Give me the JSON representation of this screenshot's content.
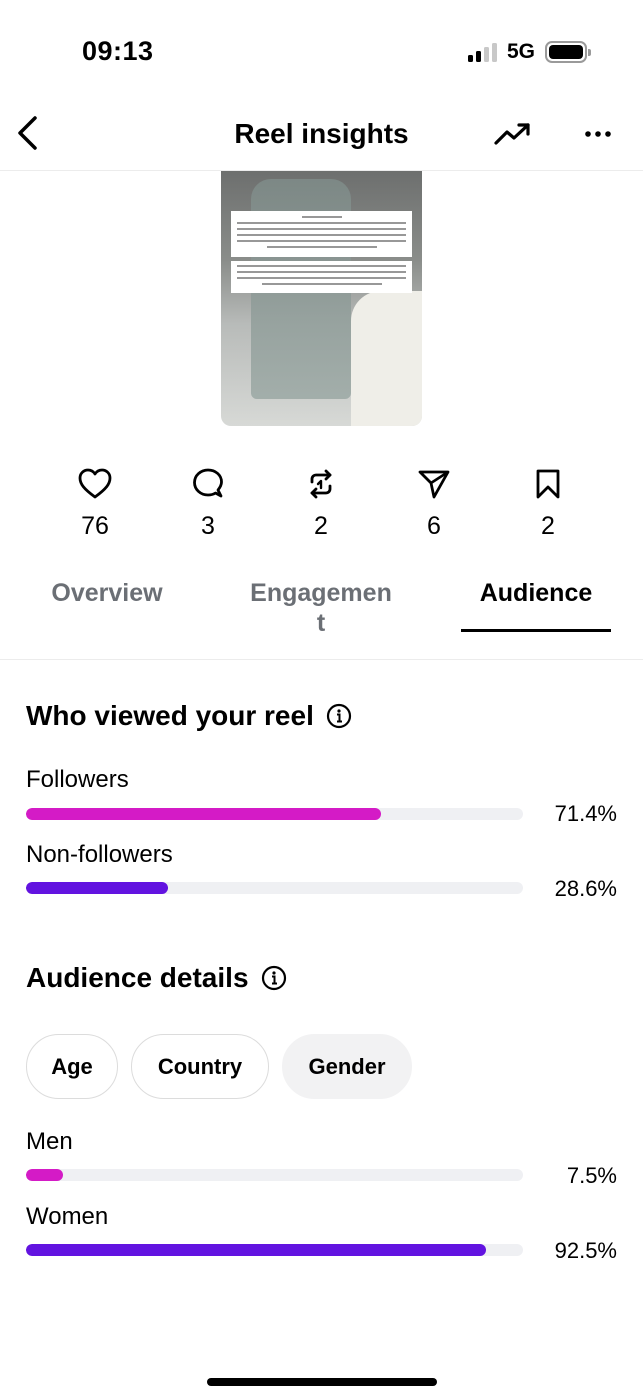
{
  "status_bar": {
    "time": "09:13",
    "network": "5G"
  },
  "header": {
    "title": "Reel insights"
  },
  "thumbnail": {
    "description": "reel video thumbnail"
  },
  "stats": [
    {
      "icon": "heart-icon",
      "value": "76"
    },
    {
      "icon": "comment-icon",
      "value": "3"
    },
    {
      "icon": "repost-icon",
      "value": "2"
    },
    {
      "icon": "share-icon",
      "value": "6"
    },
    {
      "icon": "bookmark-icon",
      "value": "2"
    }
  ],
  "tabs": [
    {
      "label": "Overview",
      "active": false
    },
    {
      "label": "Engagemen\nt",
      "active": false
    },
    {
      "label": "Audience",
      "active": true
    }
  ],
  "viewers": {
    "title": "Who viewed your reel",
    "rows": [
      {
        "label": "Followers",
        "percent": "71.4%",
        "fraction": 0.714,
        "color": "#d41bc6"
      },
      {
        "label": "Non-followers",
        "percent": "28.6%",
        "fraction": 0.286,
        "color": "#6213e0"
      }
    ]
  },
  "audience": {
    "title": "Audience details",
    "chips": [
      {
        "label": "Age",
        "selected": false
      },
      {
        "label": "Country",
        "selected": false
      },
      {
        "label": "Gender",
        "selected": true
      }
    ],
    "rows": [
      {
        "label": "Men",
        "percent": "7.5%",
        "fraction": 0.075,
        "color": "#d41bc6"
      },
      {
        "label": "Women",
        "percent": "92.5%",
        "fraction": 0.925,
        "color": "#6213e0"
      }
    ]
  }
}
